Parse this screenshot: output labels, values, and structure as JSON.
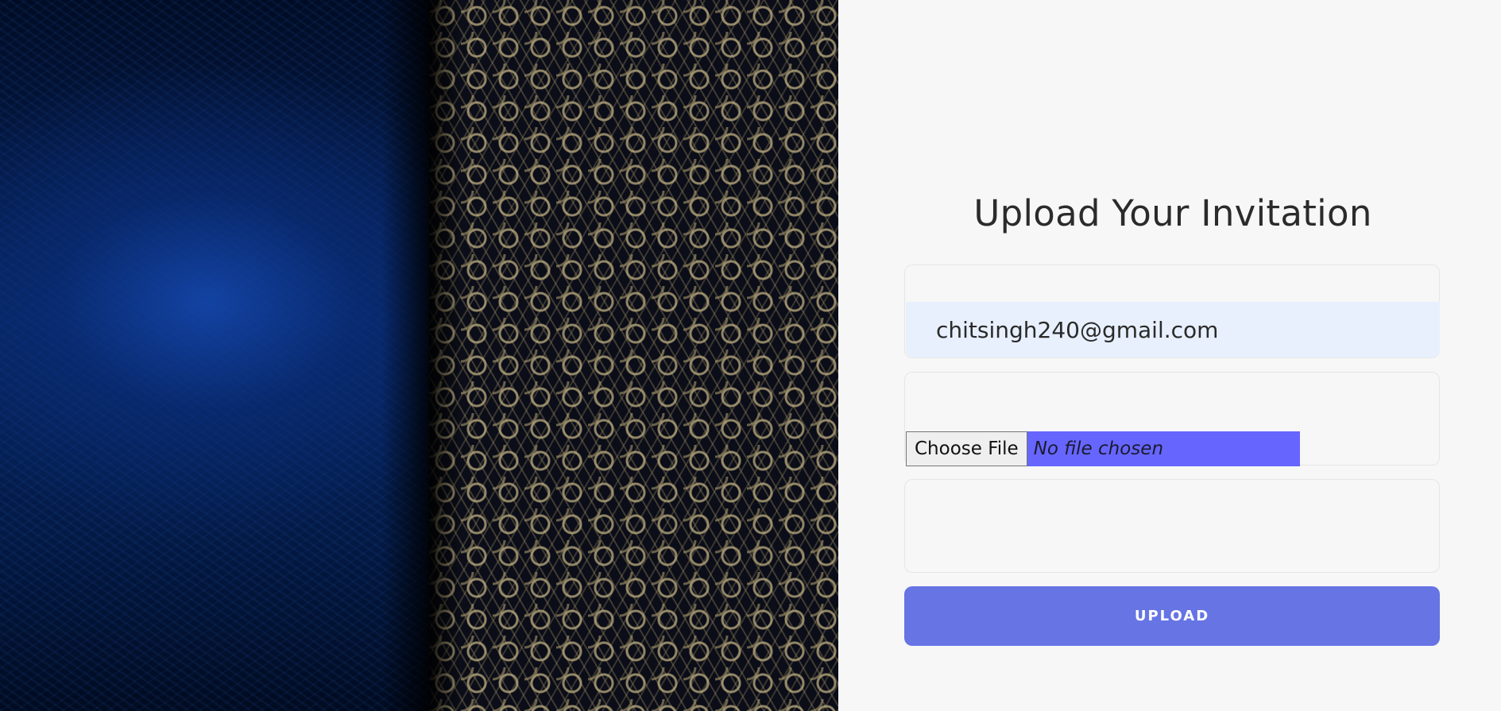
{
  "left_panel": {
    "image": "decorative-invitation-background"
  },
  "form": {
    "title": "Upload Your Invitation",
    "email_value": "chitsingh240@gmail.com",
    "file_button_label": "Choose File",
    "file_status": "No file chosen",
    "upload_label": "UPLOAD"
  },
  "colors": {
    "page_background": "#f7f7f7",
    "autofill_background": "#e8f0fe",
    "file_status_background": "#6666ff",
    "upload_button": "#6674e4"
  }
}
